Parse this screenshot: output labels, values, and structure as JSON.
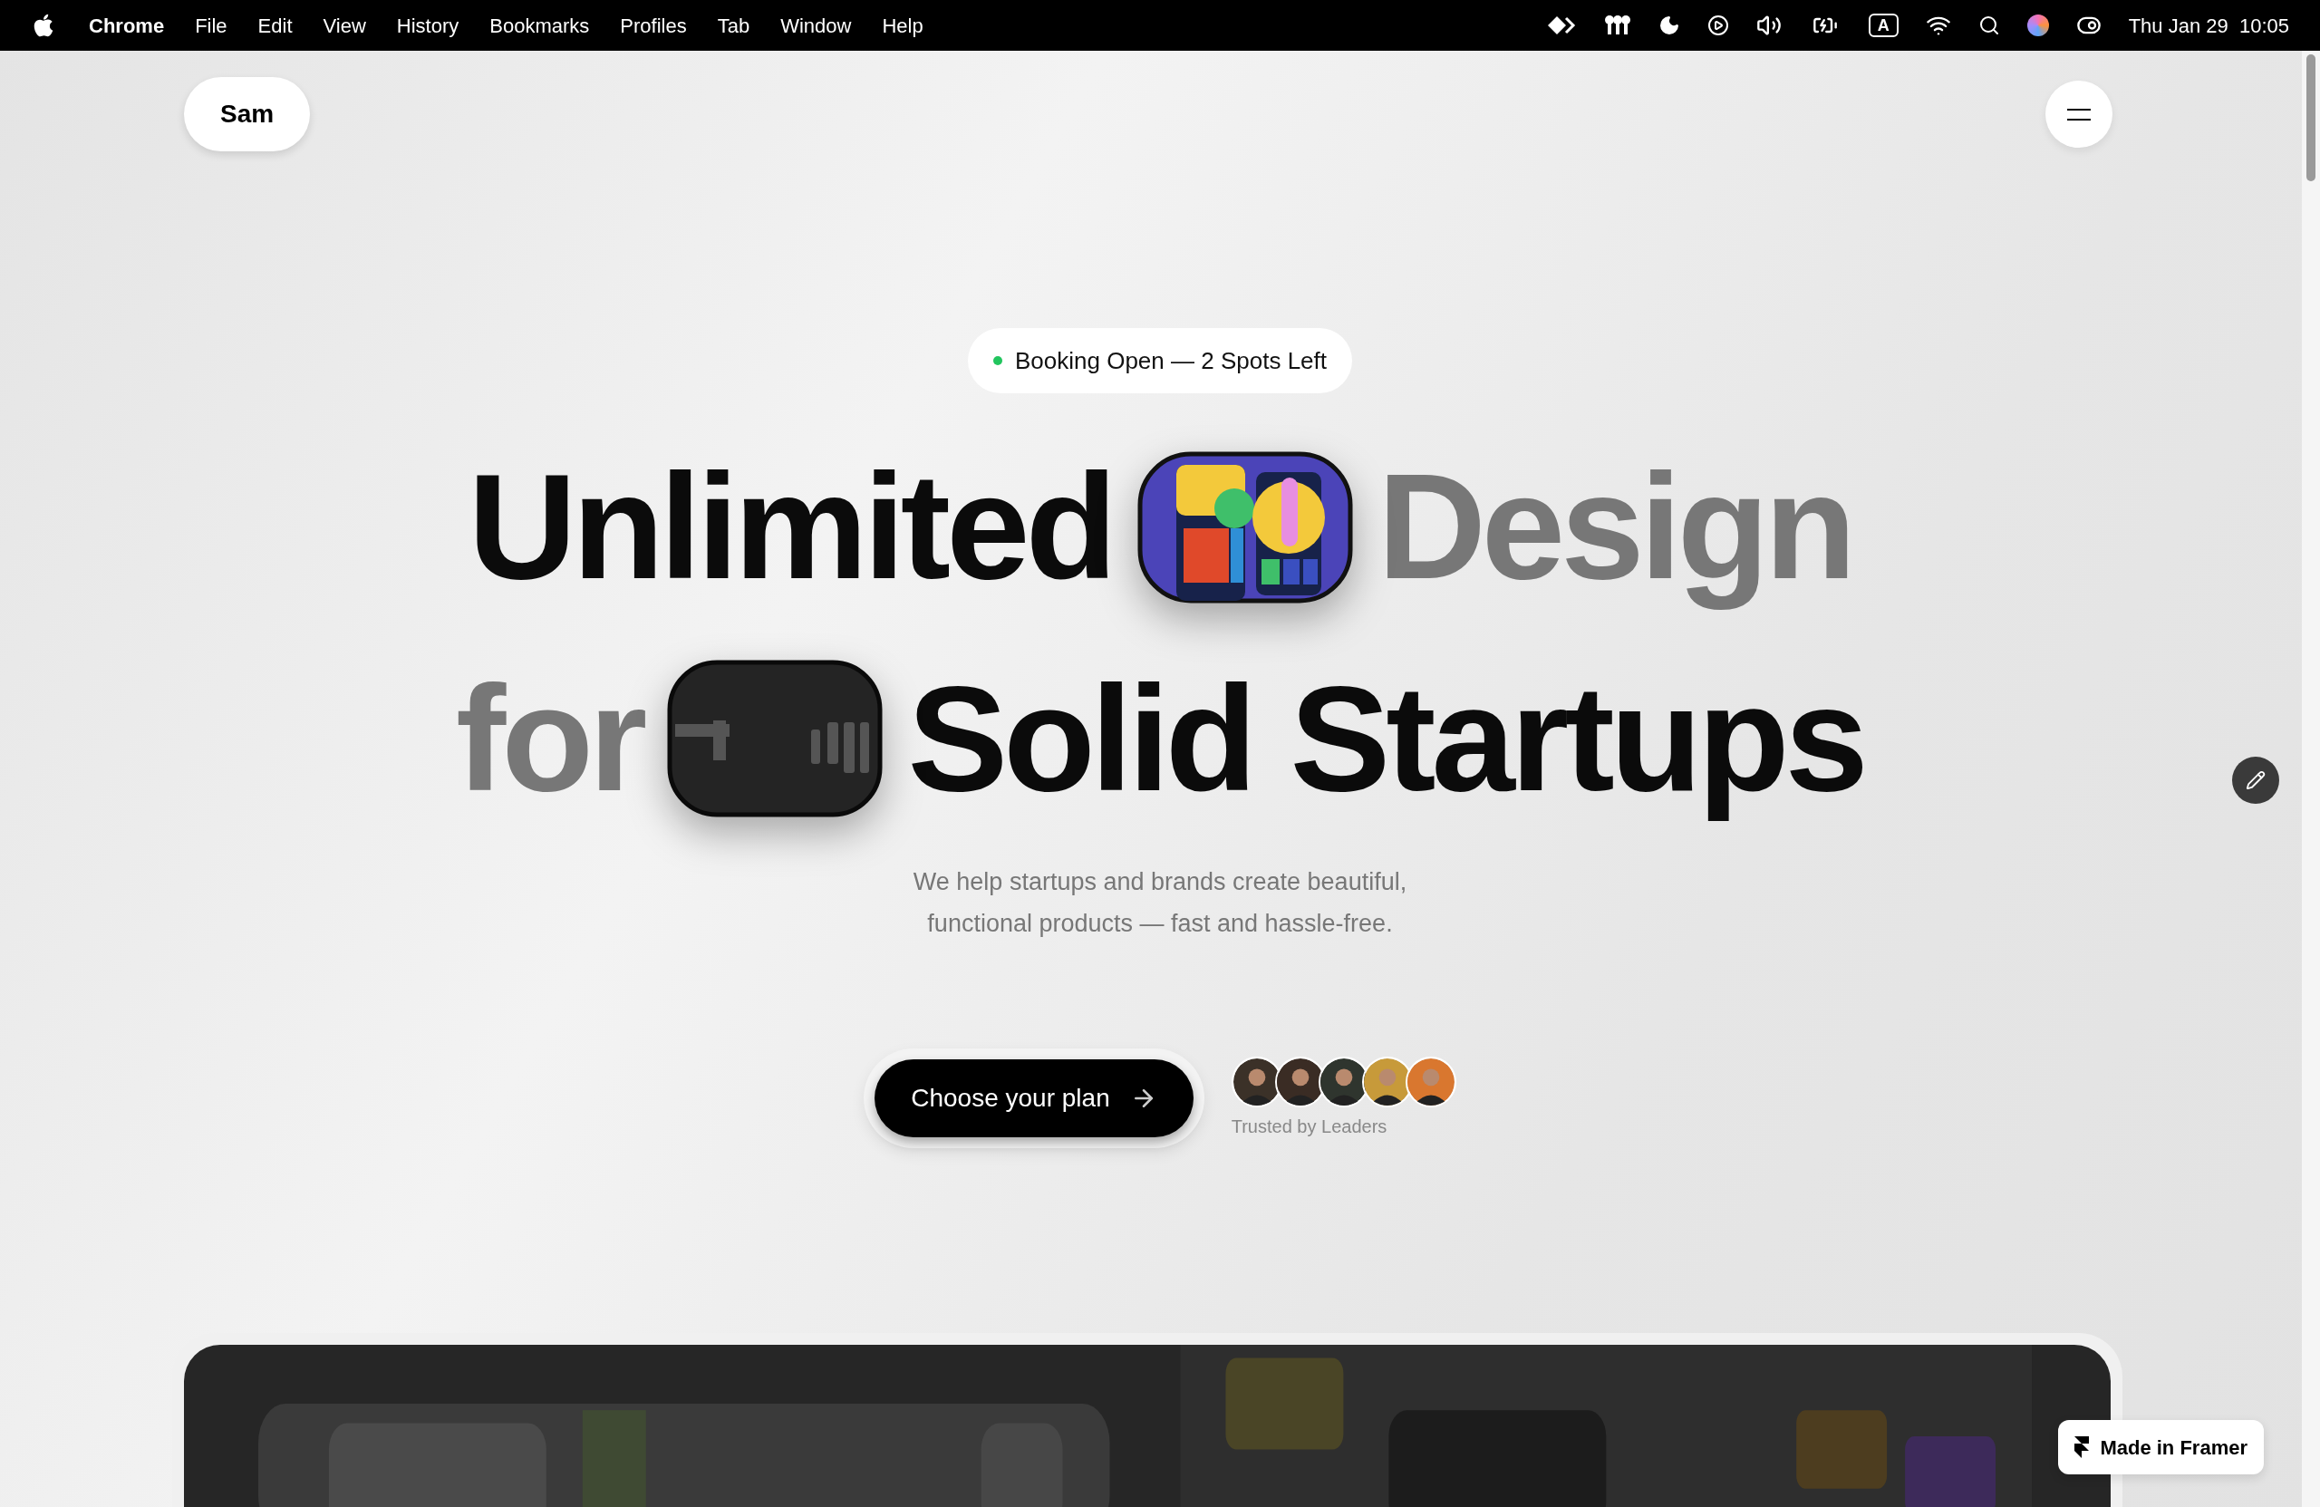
{
  "menu_bar": {
    "app": "Chrome",
    "items": [
      "File",
      "Edit",
      "View",
      "History",
      "Bookmarks",
      "Profiles",
      "Tab",
      "Window",
      "Help"
    ],
    "input_source": "A",
    "clock": "Thu Jan 29  10:05"
  },
  "header": {
    "logo": "Sam"
  },
  "hero": {
    "badge": {
      "text": "Booking Open — 2 Spots Left",
      "color": "#22c55e"
    },
    "lines": [
      [
        {
          "kind": "word",
          "text": "Unlimited",
          "color": "#0b0b0b"
        },
        {
          "kind": "picture"
        },
        {
          "kind": "word",
          "text": "Design",
          "color": "#777777"
        }
      ],
      [
        {
          "kind": "word",
          "text": "for",
          "color": "#777777"
        },
        {
          "kind": "picture"
        },
        {
          "kind": "word",
          "text": "Solid Startups",
          "color": "#0b0b0b"
        }
      ]
    ],
    "subtitle": [
      "We help startups and brands create beautiful,",
      "functional products — fast and hassle-free."
    ],
    "cta": "Choose your plan",
    "trust_caption": "Trusted by Leaders",
    "avatars": [
      {
        "color": "#3b3128"
      },
      {
        "color": "#3a2c24"
      },
      {
        "color": "#2f352e"
      },
      {
        "color": "#c79a3a"
      },
      {
        "color": "#d9772f"
      }
    ]
  },
  "framer_badge": "Made in Framer"
}
